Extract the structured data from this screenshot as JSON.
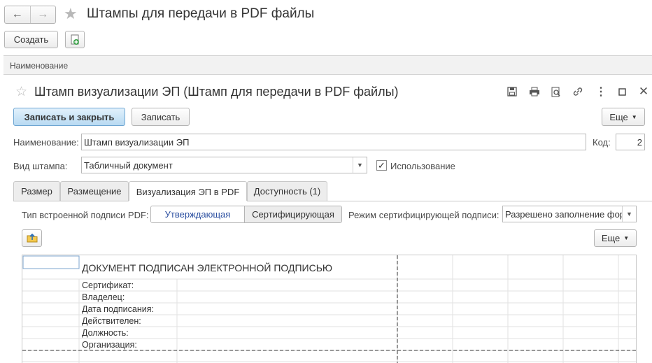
{
  "window": {
    "title": "Штампы для передачи в PDF файлы",
    "create_label": "Создать"
  },
  "list": {
    "column_header": "Наименование"
  },
  "form": {
    "title": "Штамп визуализации ЭП (Штамп для передачи в PDF файлы)",
    "save_close_label": "Записать и закрыть",
    "save_label": "Записать",
    "more_label": "Еще",
    "name_label": "Наименование:",
    "name_value": "Штамп визуализации ЭП",
    "code_label": "Код:",
    "code_value": "2",
    "stamp_type_label": "Вид штампа:",
    "stamp_type_value": "Табличный документ",
    "use_label": "Использование",
    "use_checked": true
  },
  "tabs": [
    {
      "label": "Размер",
      "active": false
    },
    {
      "label": "Размещение",
      "active": false
    },
    {
      "label": "Визуализация ЭП в PDF",
      "active": true
    },
    {
      "label": "Доступность (1)",
      "active": false
    }
  ],
  "visualization": {
    "signature_type_label": "Тип встроенной подписи PDF:",
    "signature_options": [
      "Утверждающая",
      "Сертифицирующая"
    ],
    "signature_selected": "Утверждающая",
    "certifying_mode_label": "Режим сертифицирующей подписи:",
    "certifying_mode_value": "Разрешено заполнение фор",
    "more_label": "Еще"
  },
  "sheet": {
    "heading": "ДОКУМЕНТ ПОДПИСАН ЭЛЕКТРОННОЙ ПОДПИСЬЮ",
    "rows": [
      "Сертификат:",
      "Владелец:",
      "Дата подписания:",
      "Действителен:",
      "Должность:",
      "Организация:"
    ]
  },
  "icons": {
    "back": "arrow-left-icon",
    "forward": "arrow-right-icon",
    "favorite": "star-icon",
    "copy_new": "add-copy-icon",
    "save_disk": "floppy-disk-icon",
    "print": "printer-icon",
    "preview": "print-preview-icon",
    "link": "link-icon",
    "menu": "vertical-dots-icon",
    "maximize": "maximize-icon",
    "close": "close-icon",
    "load": "folder-load-icon"
  },
  "colors": {
    "primary_button": "#b8daf2",
    "selected_option_text": "#2a4ea0",
    "header_bg": "#f2f2f2"
  }
}
